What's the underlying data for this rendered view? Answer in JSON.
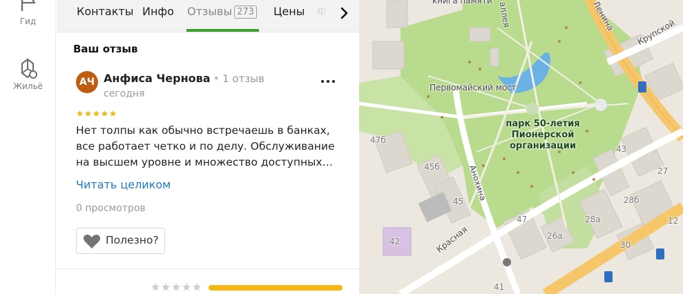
{
  "rail": {
    "guide_label": "Гид",
    "housing_label": "Жильё"
  },
  "tabs": {
    "contacts": "Контакты",
    "info": "Инфо",
    "reviews": "Отзывы",
    "reviews_count": "273",
    "prices": "Цены",
    "photos": "Ф"
  },
  "section_title": "Ваш отзыв",
  "review": {
    "avatar_initials": "АЧ",
    "author": "Анфиса Чернова",
    "author_reviews": "1 отзыв",
    "date": "сегодня",
    "rating": 5,
    "text_lines": [
      "Нет толпы как обычно встречаешь в банках,",
      "все работает четко и по делу. Обслуживание",
      "на высшем уровне и множество доступных…"
    ],
    "read_more": "Читать целиком",
    "views": "0 просмотров",
    "useful_label": "Полезно?"
  },
  "rating_summary": {
    "stars": 5,
    "bar_fill": 1.0
  },
  "map": {
    "labels": {
      "memory_book": "книга памяти",
      "bridge": "Первомайский мост",
      "park_line1": "парк 50-летия",
      "park_line2": "Пионерской",
      "park_line3": "организации",
      "street_anokhina": "Анохина",
      "street_krasnaya": "Красная",
      "street_krupskoy": "Крупской",
      "street_lenina": "Ленина",
      "street_alleya": "аллея"
    },
    "houses": [
      "47б",
      "45б",
      "45",
      "42",
      "47",
      "26а",
      "28а",
      "28б",
      "43",
      "27",
      "12",
      "30",
      "41"
    ]
  },
  "colors": {
    "accent_green": "#3aa02f",
    "link_blue": "#1e78c3",
    "star_yellow": "#f6b712",
    "avatar_brown": "#bf5d10",
    "park_green": "#b9db8e",
    "water_blue": "#6ab3e4",
    "main_road": "#f6c66a"
  }
}
